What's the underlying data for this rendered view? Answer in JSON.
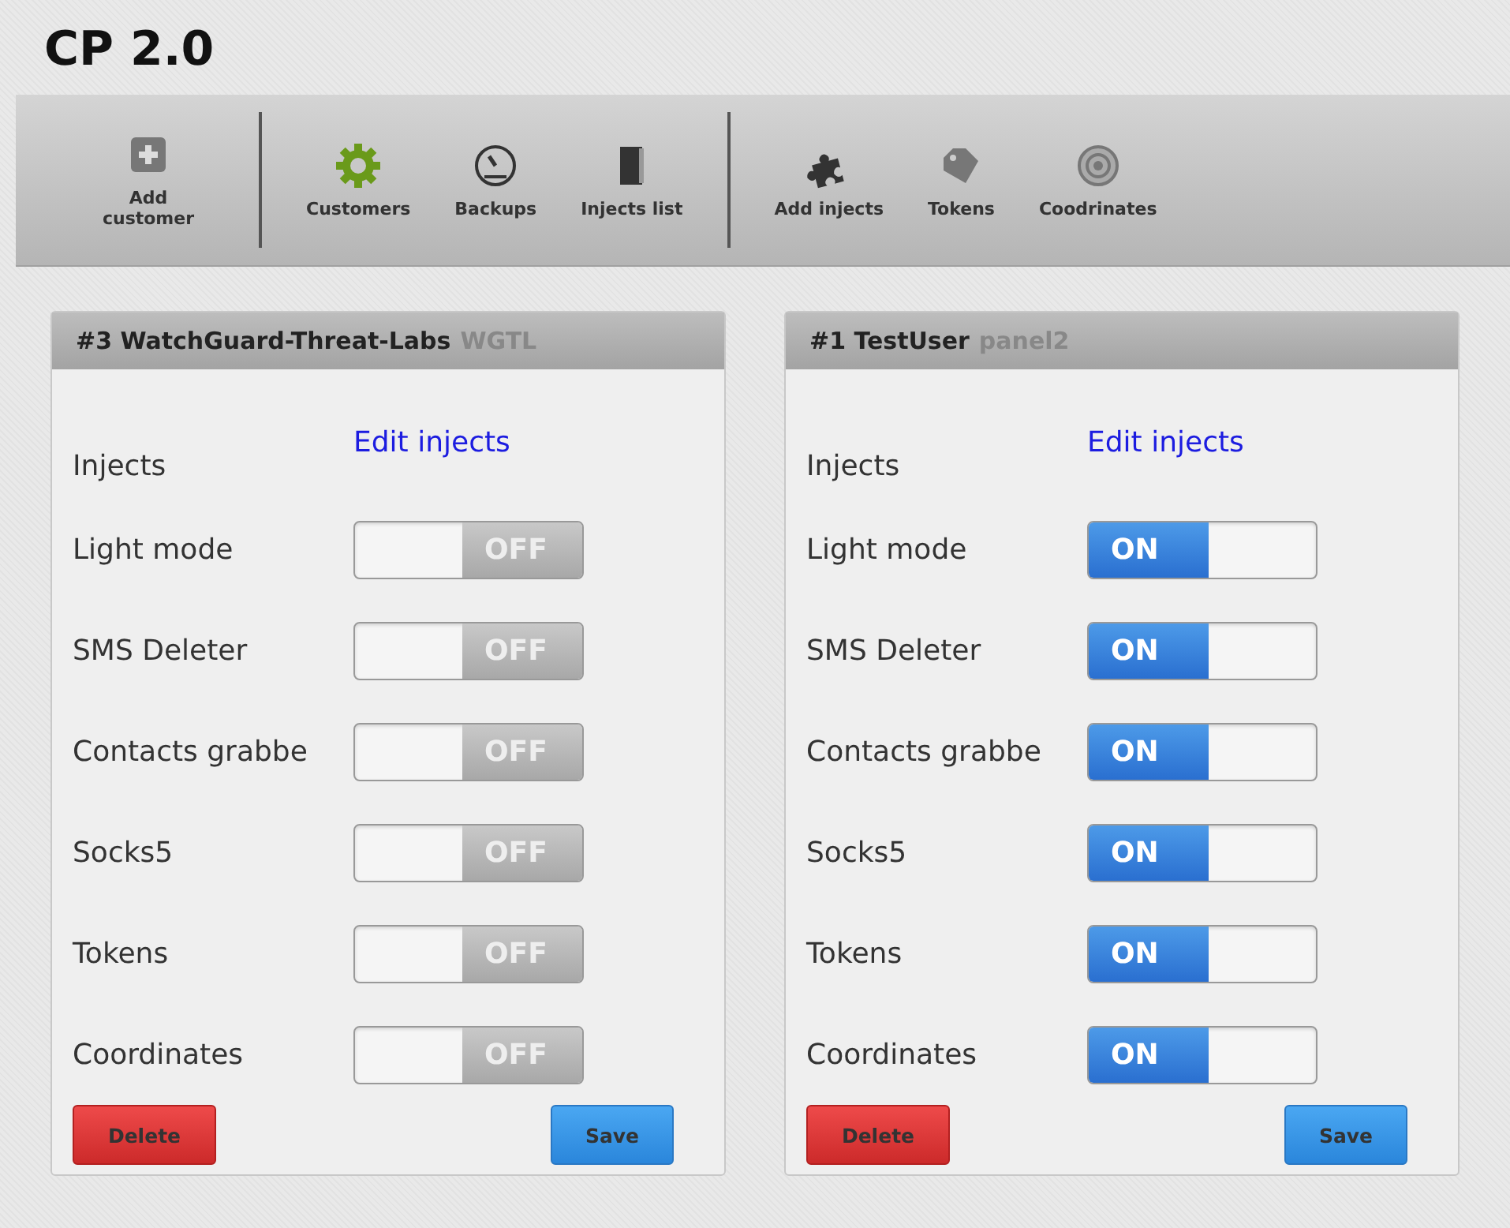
{
  "app_title": "CP 2.0",
  "toolbar": {
    "groups": [
      [
        {
          "label": "Add customer"
        }
      ],
      [
        {
          "label": "Customers"
        },
        {
          "label": "Backups"
        },
        {
          "label": "Injects list"
        }
      ],
      [
        {
          "label": "Add injects"
        },
        {
          "label": "Tokens"
        },
        {
          "label": "Coodrinates"
        }
      ]
    ]
  },
  "panels": [
    {
      "title": "#3 WatchGuard-Threat-Labs",
      "tag": "WGTL",
      "injects_label": "Injects",
      "injects_link": "Edit injects",
      "settings": [
        {
          "label": "Light mode",
          "on": false,
          "switch_text": "OFF"
        },
        {
          "label": "SMS Deleter",
          "on": false,
          "switch_text": "OFF"
        },
        {
          "label": "Contacts grabbe",
          "on": false,
          "switch_text": "OFF"
        },
        {
          "label": "Socks5",
          "on": false,
          "switch_text": "OFF"
        },
        {
          "label": "Tokens",
          "on": false,
          "switch_text": "OFF"
        },
        {
          "label": "Coordinates",
          "on": false,
          "switch_text": "OFF"
        }
      ],
      "delete_button": "Delete",
      "save_button": "Save"
    },
    {
      "title": "#1 TestUser",
      "tag": "panel2",
      "injects_label": "Injects",
      "injects_link": "Edit injects",
      "settings": [
        {
          "label": "Light mode",
          "on": true,
          "switch_text": "ON"
        },
        {
          "label": "SMS Deleter",
          "on": true,
          "switch_text": "ON"
        },
        {
          "label": "Contacts grabbe",
          "on": true,
          "switch_text": "ON"
        },
        {
          "label": "Socks5",
          "on": true,
          "switch_text": "ON"
        },
        {
          "label": "Tokens",
          "on": true,
          "switch_text": "ON"
        },
        {
          "label": "Coordinates",
          "on": true,
          "switch_text": "ON"
        }
      ],
      "delete_button": "Delete",
      "save_button": "Save"
    }
  ]
}
